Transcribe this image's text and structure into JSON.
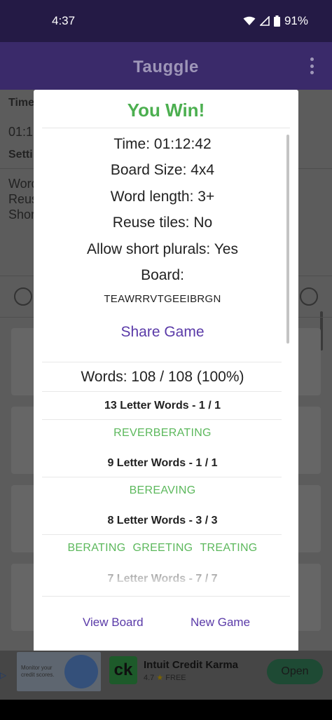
{
  "status_bar": {
    "time": "4:37",
    "battery": "91%"
  },
  "app_bar": {
    "title": "Tauggle"
  },
  "background": {
    "time_label": "Time",
    "time_value": "01:1",
    "settings_label": "Setti",
    "settings_lines": [
      "Word",
      "Reus",
      "Shor"
    ]
  },
  "dialog": {
    "title": "You Win!",
    "info": {
      "time": "Time: 01:12:42",
      "board_size": "Board Size: 4x4",
      "word_length": "Word length: 3+",
      "reuse_tiles": "Reuse tiles: No",
      "short_plurals": "Allow short plurals: Yes",
      "board_label": "Board:"
    },
    "board_letters": "TEAWRRVTGEEIBRGN",
    "share_label": "Share Game",
    "words_summary": "Words: 108 / 108 (100%)",
    "groups": [
      {
        "header": "13 Letter Words - 1 / 1",
        "words": [
          "REVERBERATING"
        ]
      },
      {
        "header": "9 Letter Words - 1 / 1",
        "words": [
          "BEREAVING"
        ]
      },
      {
        "header": "8 Letter Words - 3 / 3",
        "words": [
          "BERATING",
          "GREETING",
          "TREATING"
        ]
      },
      {
        "header": "7 Letter Words - 7 / 7",
        "words": []
      }
    ],
    "buttons": {
      "view_board": "View Board",
      "new_game": "New Game"
    }
  },
  "ad": {
    "image_text": "Monitor your credit scores.",
    "logo_text": "ck",
    "app_name": "Intuit Credit Karma",
    "rating": "4.7",
    "price": "FREE",
    "cta": "Open"
  }
}
